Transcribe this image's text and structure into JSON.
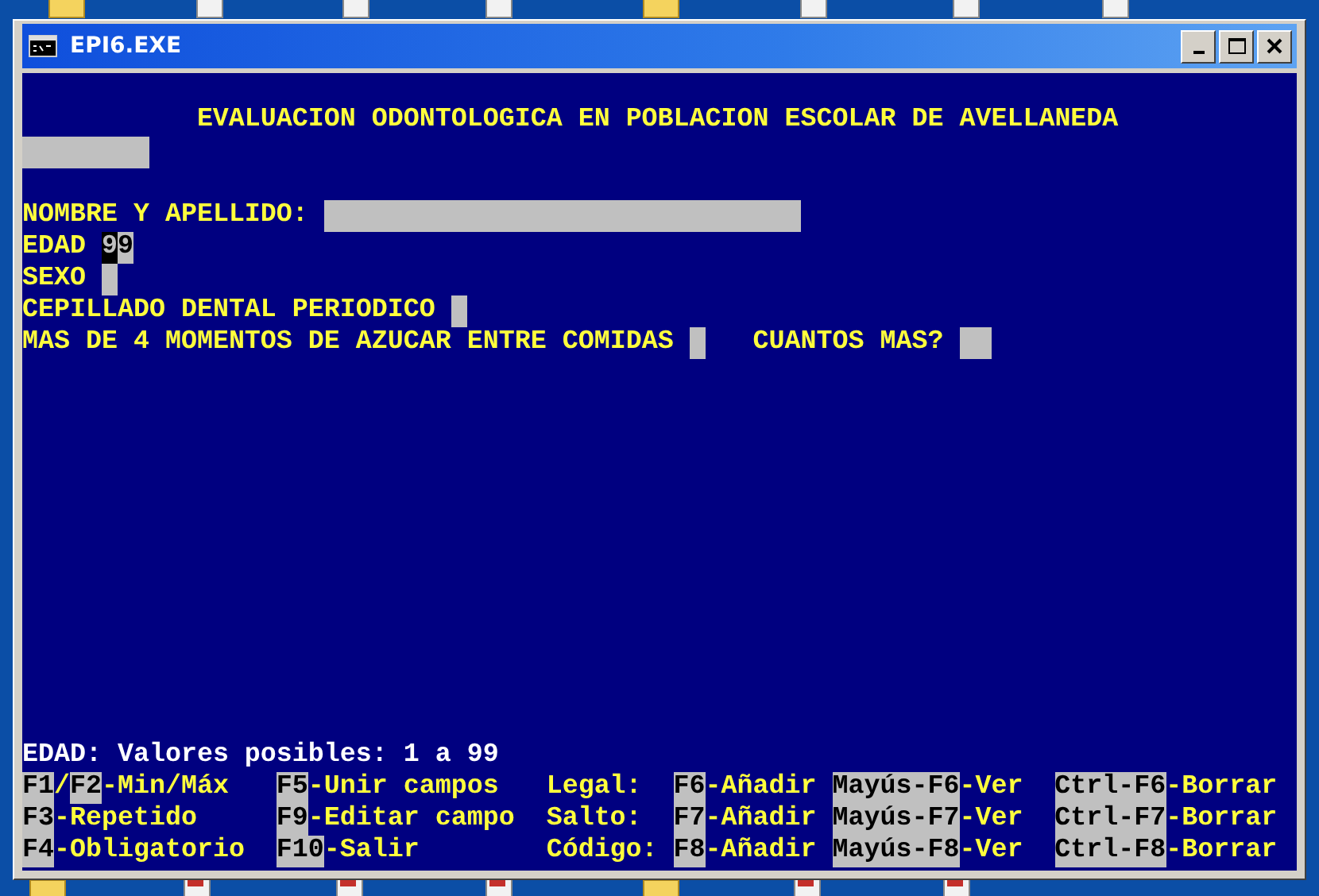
{
  "window": {
    "title": "EPI6.EXE"
  },
  "heading": "EVALUACION ODONTOLOGICA EN POBLACION ESCOLAR DE AVELLANEDA",
  "form": {
    "rows": [
      {
        "items": [
          {
            "kind": "field",
            "cursor": false
          }
        ]
      },
      {
        "items": []
      },
      {
        "items": [
          {
            "kind": "label",
            "text": "NOMBRE Y APELLIDO:"
          },
          {
            "kind": "field",
            "cursor": false
          }
        ]
      },
      {
        "items": [
          {
            "kind": "label",
            "text": "EDAD"
          },
          {
            "kind": "field",
            "value": "99",
            "cursor": true
          }
        ]
      },
      {
        "items": [
          {
            "kind": "label",
            "text": "SEXO"
          },
          {
            "kind": "field",
            "cursor": false
          }
        ]
      },
      {
        "items": [
          {
            "kind": "label",
            "text": "CEPILLADO DENTAL PERIODICO"
          },
          {
            "kind": "field",
            "cursor": false
          }
        ]
      },
      {
        "items": [
          {
            "kind": "label",
            "text": "MAS DE 4 MOMENTOS DE AZUCAR ENTRE COMIDAS"
          },
          {
            "kind": "field",
            "cursor": false
          },
          {
            "kind": "label",
            "text": "CUANTOS MAS?"
          },
          {
            "kind": "field",
            "cursor": false
          }
        ]
      }
    ]
  },
  "hint": "EDAD: Valores posibles: 1 a 99",
  "key_lines": [
    {
      "cells": [
        [
          {
            "kind": "key",
            "text": "F1"
          },
          {
            "kind": "text",
            "text": "/"
          },
          {
            "kind": "key",
            "text": "F2"
          },
          {
            "kind": "text",
            "text": "-Min/Máx"
          }
        ],
        [
          {
            "kind": "key",
            "text": "F5"
          },
          {
            "kind": "text",
            "text": "-Unir campos"
          }
        ],
        [
          {
            "kind": "text",
            "text": "Legal:"
          }
        ],
        [
          {
            "kind": "key",
            "text": "F6"
          },
          {
            "kind": "text",
            "text": "-Añadir"
          }
        ],
        [
          {
            "kind": "key",
            "text": "Mayús-F6"
          },
          {
            "kind": "text",
            "text": "-Ver"
          }
        ],
        [
          {
            "kind": "key",
            "text": "Ctrl-F6"
          },
          {
            "kind": "text",
            "text": "-Borrar"
          }
        ]
      ]
    },
    {
      "cells": [
        [
          {
            "kind": "key",
            "text": "F3"
          },
          {
            "kind": "text",
            "text": "-Repetido"
          }
        ],
        [
          {
            "kind": "key",
            "text": "F9"
          },
          {
            "kind": "text",
            "text": "-Editar campo"
          }
        ],
        [
          {
            "kind": "text",
            "text": "Salto:"
          }
        ],
        [
          {
            "kind": "key",
            "text": "F7"
          },
          {
            "kind": "text",
            "text": "-Añadir"
          }
        ],
        [
          {
            "kind": "key",
            "text": "Mayús-F7"
          },
          {
            "kind": "text",
            "text": "-Ver"
          }
        ],
        [
          {
            "kind": "key",
            "text": "Ctrl-F7"
          },
          {
            "kind": "text",
            "text": "-Borrar"
          }
        ]
      ]
    },
    {
      "cells": [
        [
          {
            "kind": "key",
            "text": "F4"
          },
          {
            "kind": "text",
            "text": "-Obligatorio"
          }
        ],
        [
          {
            "kind": "key",
            "text": "F10"
          },
          {
            "kind": "text",
            "text": "-Salir"
          }
        ],
        [
          {
            "kind": "text",
            "text": "Código:"
          }
        ],
        [
          {
            "kind": "key",
            "text": "F8"
          },
          {
            "kind": "text",
            "text": "-Añadir"
          }
        ],
        [
          {
            "kind": "key",
            "text": "Mayús-F8"
          },
          {
            "kind": "text",
            "text": "-Ver"
          }
        ],
        [
          {
            "kind": "key",
            "text": "Ctrl-F8"
          },
          {
            "kind": "text",
            "text": "-Borrar"
          }
        ]
      ]
    }
  ]
}
